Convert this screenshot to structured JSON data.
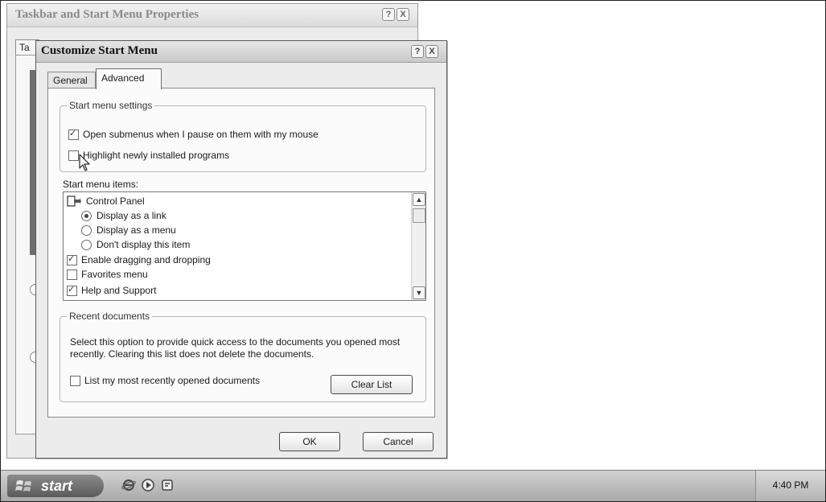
{
  "background_dialog": {
    "title": "Taskbar and Start Menu Properties",
    "tab_fragment": "Ta",
    "help_glyph": "?",
    "close_glyph": "X"
  },
  "dialog": {
    "title": "Customize Start Menu",
    "help_glyph": "?",
    "close_glyph": "X",
    "tabs": [
      {
        "label": "General",
        "selected": false
      },
      {
        "label": "Advanced",
        "selected": true
      }
    ],
    "start_menu_settings": {
      "legend": "Start menu settings",
      "options": [
        {
          "label": "Open submenus when I pause on them with my mouse",
          "checked": true
        },
        {
          "label": "Highlight newly installed programs",
          "checked": false
        }
      ]
    },
    "start_menu_items": {
      "label": "Start menu items:",
      "control_panel": {
        "label": "Control Panel",
        "icon": "control-panel-icon",
        "options": [
          {
            "label": "Display as a link",
            "selected": true
          },
          {
            "label": "Display as a menu",
            "selected": false
          },
          {
            "label": "Don't display this item",
            "selected": false
          }
        ]
      },
      "enable_drag_drop": {
        "label": "Enable dragging and dropping",
        "checked": true
      },
      "favorites_menu": {
        "label": "Favorites menu",
        "checked": false
      },
      "help_support": {
        "label": "Help and Support",
        "checked": true
      }
    },
    "recent_documents": {
      "legend": "Recent documents",
      "description": "Select this option to provide quick access to the documents you opened most recently.  Clearing this list does not delete the documents.",
      "list_option": {
        "label": "List my most recently opened documents",
        "checked": false
      },
      "clear_button": "Clear List"
    },
    "ok_button": "OK",
    "cancel_button": "Cancel"
  },
  "taskbar": {
    "start_label": "start",
    "quick_launch": [
      "internet-explorer-icon",
      "media-player-icon",
      "show-desktop-icon"
    ],
    "clock": "4:40 PM"
  }
}
